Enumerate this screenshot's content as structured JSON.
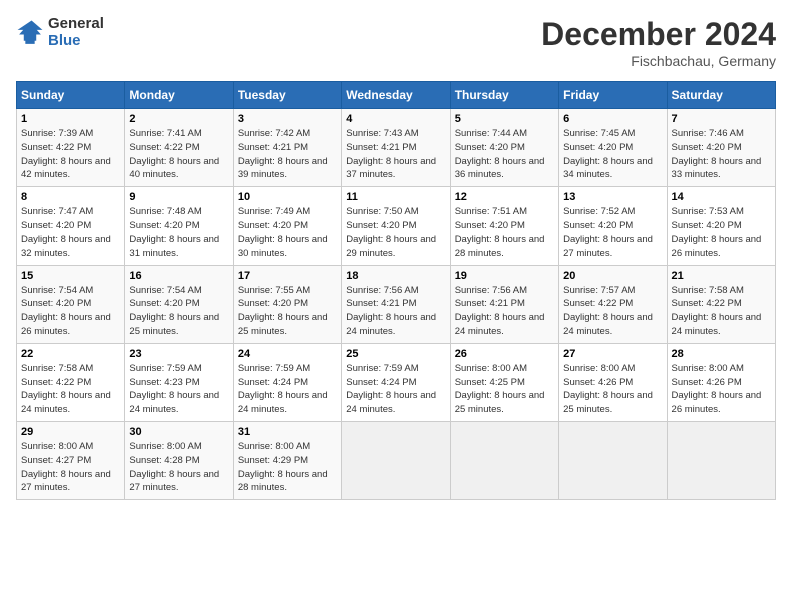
{
  "logo": {
    "general": "General",
    "blue": "Blue"
  },
  "title": "December 2024",
  "location": "Fischbachau, Germany",
  "weekdays": [
    "Sunday",
    "Monday",
    "Tuesday",
    "Wednesday",
    "Thursday",
    "Friday",
    "Saturday"
  ],
  "weeks": [
    [
      {
        "day": "1",
        "sunrise": "7:39 AM",
        "sunset": "4:22 PM",
        "daylight": "8 hours and 42 minutes."
      },
      {
        "day": "2",
        "sunrise": "7:41 AM",
        "sunset": "4:22 PM",
        "daylight": "8 hours and 40 minutes."
      },
      {
        "day": "3",
        "sunrise": "7:42 AM",
        "sunset": "4:21 PM",
        "daylight": "8 hours and 39 minutes."
      },
      {
        "day": "4",
        "sunrise": "7:43 AM",
        "sunset": "4:21 PM",
        "daylight": "8 hours and 37 minutes."
      },
      {
        "day": "5",
        "sunrise": "7:44 AM",
        "sunset": "4:20 PM",
        "daylight": "8 hours and 36 minutes."
      },
      {
        "day": "6",
        "sunrise": "7:45 AM",
        "sunset": "4:20 PM",
        "daylight": "8 hours and 34 minutes."
      },
      {
        "day": "7",
        "sunrise": "7:46 AM",
        "sunset": "4:20 PM",
        "daylight": "8 hours and 33 minutes."
      }
    ],
    [
      {
        "day": "8",
        "sunrise": "7:47 AM",
        "sunset": "4:20 PM",
        "daylight": "8 hours and 32 minutes."
      },
      {
        "day": "9",
        "sunrise": "7:48 AM",
        "sunset": "4:20 PM",
        "daylight": "8 hours and 31 minutes."
      },
      {
        "day": "10",
        "sunrise": "7:49 AM",
        "sunset": "4:20 PM",
        "daylight": "8 hours and 30 minutes."
      },
      {
        "day": "11",
        "sunrise": "7:50 AM",
        "sunset": "4:20 PM",
        "daylight": "8 hours and 29 minutes."
      },
      {
        "day": "12",
        "sunrise": "7:51 AM",
        "sunset": "4:20 PM",
        "daylight": "8 hours and 28 minutes."
      },
      {
        "day": "13",
        "sunrise": "7:52 AM",
        "sunset": "4:20 PM",
        "daylight": "8 hours and 27 minutes."
      },
      {
        "day": "14",
        "sunrise": "7:53 AM",
        "sunset": "4:20 PM",
        "daylight": "8 hours and 26 minutes."
      }
    ],
    [
      {
        "day": "15",
        "sunrise": "7:54 AM",
        "sunset": "4:20 PM",
        "daylight": "8 hours and 26 minutes."
      },
      {
        "day": "16",
        "sunrise": "7:54 AM",
        "sunset": "4:20 PM",
        "daylight": "8 hours and 25 minutes."
      },
      {
        "day": "17",
        "sunrise": "7:55 AM",
        "sunset": "4:20 PM",
        "daylight": "8 hours and 25 minutes."
      },
      {
        "day": "18",
        "sunrise": "7:56 AM",
        "sunset": "4:21 PM",
        "daylight": "8 hours and 24 minutes."
      },
      {
        "day": "19",
        "sunrise": "7:56 AM",
        "sunset": "4:21 PM",
        "daylight": "8 hours and 24 minutes."
      },
      {
        "day": "20",
        "sunrise": "7:57 AM",
        "sunset": "4:22 PM",
        "daylight": "8 hours and 24 minutes."
      },
      {
        "day": "21",
        "sunrise": "7:58 AM",
        "sunset": "4:22 PM",
        "daylight": "8 hours and 24 minutes."
      }
    ],
    [
      {
        "day": "22",
        "sunrise": "7:58 AM",
        "sunset": "4:22 PM",
        "daylight": "8 hours and 24 minutes."
      },
      {
        "day": "23",
        "sunrise": "7:59 AM",
        "sunset": "4:23 PM",
        "daylight": "8 hours and 24 minutes."
      },
      {
        "day": "24",
        "sunrise": "7:59 AM",
        "sunset": "4:24 PM",
        "daylight": "8 hours and 24 minutes."
      },
      {
        "day": "25",
        "sunrise": "7:59 AM",
        "sunset": "4:24 PM",
        "daylight": "8 hours and 24 minutes."
      },
      {
        "day": "26",
        "sunrise": "8:00 AM",
        "sunset": "4:25 PM",
        "daylight": "8 hours and 25 minutes."
      },
      {
        "day": "27",
        "sunrise": "8:00 AM",
        "sunset": "4:26 PM",
        "daylight": "8 hours and 25 minutes."
      },
      {
        "day": "28",
        "sunrise": "8:00 AM",
        "sunset": "4:26 PM",
        "daylight": "8 hours and 26 minutes."
      }
    ],
    [
      {
        "day": "29",
        "sunrise": "8:00 AM",
        "sunset": "4:27 PM",
        "daylight": "8 hours and 27 minutes."
      },
      {
        "day": "30",
        "sunrise": "8:00 AM",
        "sunset": "4:28 PM",
        "daylight": "8 hours and 27 minutes."
      },
      {
        "day": "31",
        "sunrise": "8:00 AM",
        "sunset": "4:29 PM",
        "daylight": "8 hours and 28 minutes."
      },
      null,
      null,
      null,
      null
    ]
  ]
}
